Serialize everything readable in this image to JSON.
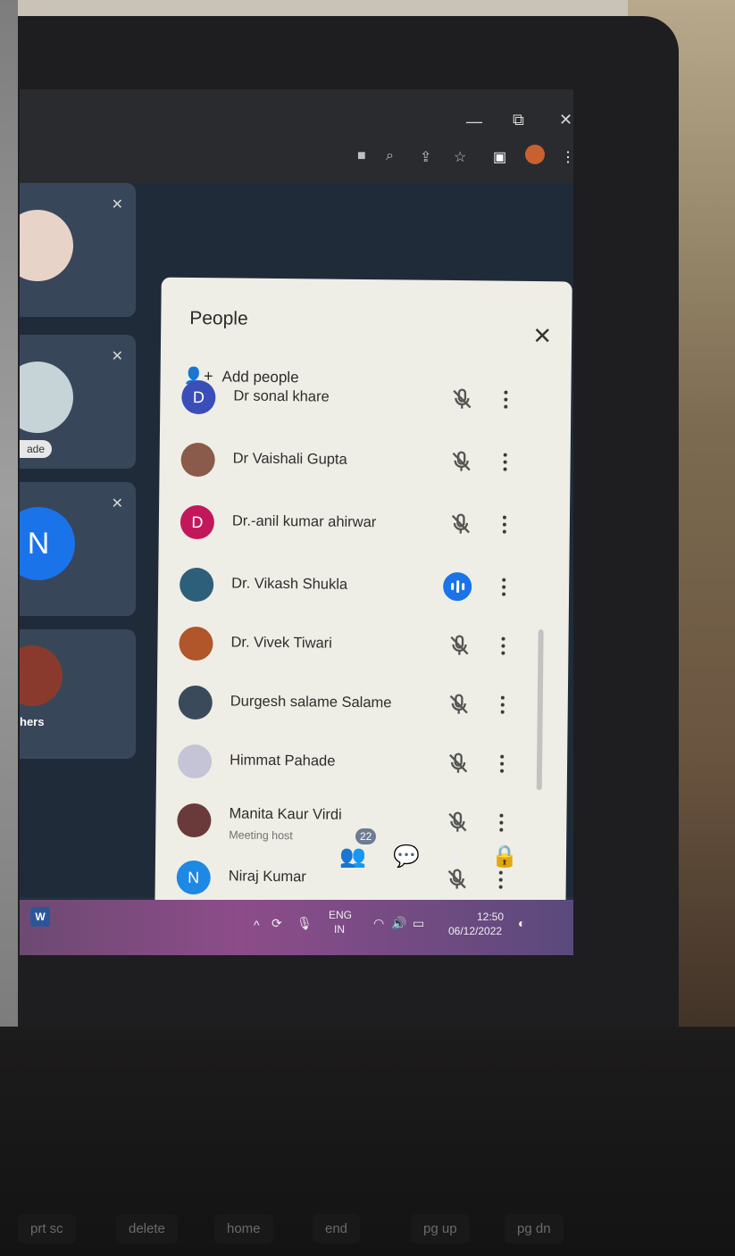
{
  "browser": {
    "minimize": "—",
    "restore": "⧉",
    "close": "✕"
  },
  "tiles": {
    "label_ade": "ade",
    "label_hers": "hers",
    "letter_n": "N"
  },
  "panel": {
    "title": "People",
    "close_icon": "✕",
    "add_people_label": "Add people",
    "participants": [
      {
        "initial": "D",
        "name": "Dr sonal khare",
        "subtitle": "",
        "avatar_color": "#3b4db8",
        "speaking": false
      },
      {
        "initial": "",
        "name": "Dr Vaishali Gupta",
        "subtitle": "",
        "avatar_color": "#8a5a4a",
        "speaking": false
      },
      {
        "initial": "D",
        "name": "Dr.-anil kumar ahirwar",
        "subtitle": "",
        "avatar_color": "#c2185b",
        "speaking": false
      },
      {
        "initial": "",
        "name": "Dr. Vikash Shukla",
        "subtitle": "",
        "avatar_color": "#2e5f7a",
        "speaking": true
      },
      {
        "initial": "",
        "name": "Dr. Vivek Tiwari",
        "subtitle": "",
        "avatar_color": "#b1552b",
        "speaking": false
      },
      {
        "initial": "",
        "name": "Durgesh salame Salame",
        "subtitle": "",
        "avatar_color": "#3a4a5a",
        "speaking": false
      },
      {
        "initial": "",
        "name": "Himmat Pahade",
        "subtitle": "",
        "avatar_color": "#c4c4d6",
        "speaking": false
      },
      {
        "initial": "",
        "name": "Manita Kaur Virdi",
        "subtitle": "Meeting host",
        "avatar_color": "#6a3a3a",
        "speaking": false
      },
      {
        "initial": "N",
        "name": "Niraj Kumar",
        "subtitle": "",
        "avatar_color": "#1e88e5",
        "speaking": false
      }
    ]
  },
  "controls": {
    "people_count": "22"
  },
  "taskbar": {
    "word_icon_letter": "W",
    "lang_top": "ENG",
    "lang_bottom": "IN",
    "time": "12:50",
    "date": "06/12/2022"
  },
  "keyboard": {
    "keys": [
      "prt sc",
      "delete",
      "home",
      "end",
      "pg up",
      "pg dn"
    ]
  }
}
